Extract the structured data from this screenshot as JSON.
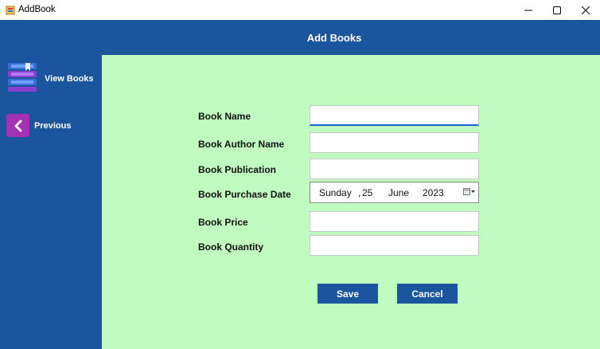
{
  "window": {
    "title": "AddBook",
    "icon": "book-app-icon",
    "controls": [
      "minimize-icon",
      "maximize-icon",
      "close-icon"
    ]
  },
  "header": {
    "title": "Add Books"
  },
  "sidebar": {
    "items": [
      {
        "label": "View Books",
        "icon": "books-stack-icon"
      },
      {
        "label": "Previous",
        "icon": "chevron-left-icon"
      }
    ]
  },
  "form": {
    "book_name": {
      "label": "Book Name",
      "value": ""
    },
    "author_name": {
      "label": "Book Author Name",
      "value": ""
    },
    "publication": {
      "label": "Book Publication",
      "value": ""
    },
    "purchase_date": {
      "label": "Book Purchase Date",
      "weekday": "Sunday",
      "sep": ",",
      "day": "25",
      "month": "June",
      "year": "2023"
    },
    "price": {
      "label": "Book Price",
      "value": ""
    },
    "quantity": {
      "label": "Book Quantity",
      "value": ""
    }
  },
  "buttons": {
    "save": "Save",
    "cancel": "Cancel"
  },
  "colors": {
    "header_bg": "#1a559d",
    "sidebar_bg": "#1a559d",
    "main_bg": "#c0fbc0",
    "button_bg": "#1a559d",
    "accent_prev": "#a430b3"
  }
}
